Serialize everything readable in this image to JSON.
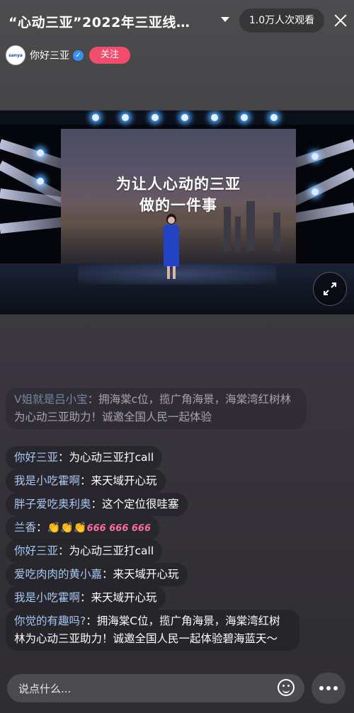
{
  "header": {
    "title": "“心动三亚”2022年三亚线…",
    "viewers": "1.0万人次观看"
  },
  "host": {
    "avatar_text": "sanya",
    "name": "你好三亚",
    "follow_label": "关注"
  },
  "video": {
    "screen_line1": "为让人心动的三亚",
    "screen_line2": "做的一件事"
  },
  "chat": [
    {
      "user": "V姐就是吕小宝",
      "text": "拥海棠c位，揽广角海景，海棠湾红树林为心动三亚助力！诚邀全国人民一起体验"
    },
    {
      "user": "你好三亚",
      "text": "为心动三亚打call"
    },
    {
      "user": "我是小吃霍啊",
      "text": "来天域开心玩"
    },
    {
      "user": "胖子爱吃奥利奥",
      "text": "这个定位很哇塞"
    },
    {
      "user": "兰香",
      "text": "👏👏👏",
      "extra": "666 666 666"
    },
    {
      "user": "你好三亚",
      "text": "为心动三亚打call"
    },
    {
      "user": "爱吃肉肉的黄小嘉",
      "text": "来天域开心玩"
    },
    {
      "user": "我是小吃霍啊",
      "text": "来天域开心玩"
    },
    {
      "user": "你觉的有趣吗?",
      "text": "拥海棠C位，揽广角海景，海棠湾红树林为心动三亚助力！诚邀全国人民一起体验碧海蓝天～"
    }
  ],
  "footer": {
    "input_placeholder": "说点什么..."
  },
  "icons": [
    "chevron-down-icon",
    "close-icon",
    "verified-icon",
    "fullscreen-icon",
    "smile-icon",
    "more-icon"
  ],
  "colors": {
    "follow": "#f24d6b",
    "username": "#a8c8f2",
    "verified": "#3a8ff0"
  }
}
